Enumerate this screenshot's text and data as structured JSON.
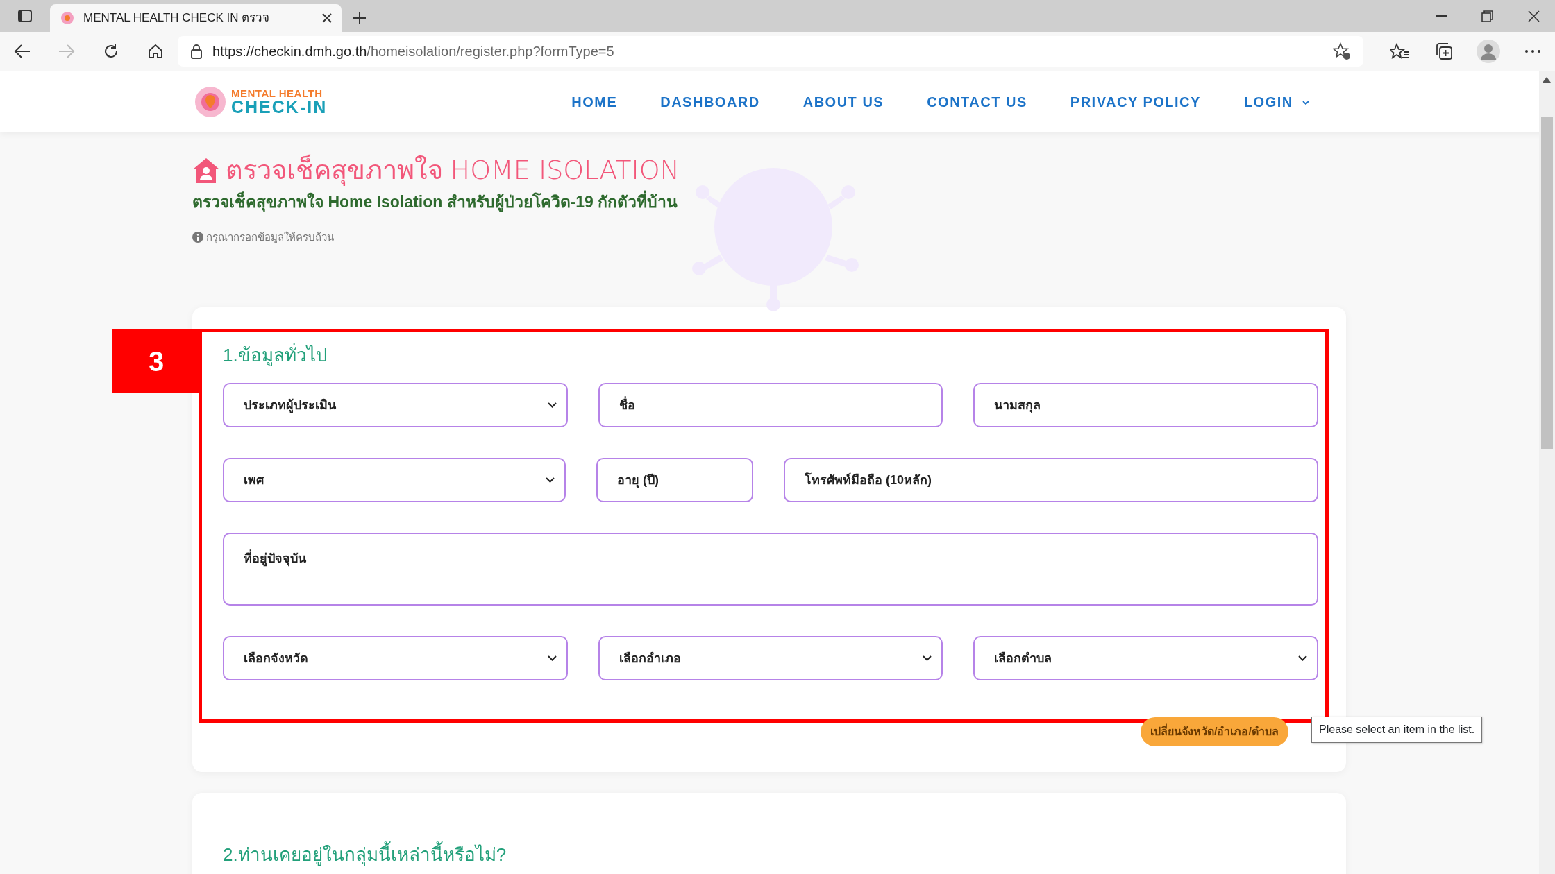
{
  "browser": {
    "tab_title": "MENTAL HEALTH CHECK IN ตรวจ",
    "url_host": "https://checkin.dmh.go.th",
    "url_path": "/homeisolation/register.php?formType=5"
  },
  "site": {
    "logo_top": "MENTAL HEALTH",
    "logo_bottom": "CHECK-IN",
    "nav": [
      {
        "label": "HOME",
        "dropdown": false
      },
      {
        "label": "DASHBOARD",
        "dropdown": false
      },
      {
        "label": "ABOUT US",
        "dropdown": false
      },
      {
        "label": "CONTACT US",
        "dropdown": false
      },
      {
        "label": "PRIVACY POLICY",
        "dropdown": false
      },
      {
        "label": "LOGIN",
        "dropdown": true
      }
    ]
  },
  "page": {
    "title_thai": "ตรวจเช็คสุขภาพใจ",
    "title_en": "HOME ISOLATION",
    "subtitle": "ตรวจเช็คสุขภาพใจ Home Isolation สำหรับผู้ป่วยโควิด-19 กักตัวที่บ้าน",
    "notice": "กรุณากรอกข้อมูลให้ครบถ้วน"
  },
  "annotation": {
    "label": "3"
  },
  "section_1": {
    "heading": "1.ข้อมูลทั่วไป",
    "rows": [
      [
        {
          "kind": "select",
          "value": "ประเภทผู้ประเมิน"
        },
        {
          "kind": "input",
          "placeholder": "ชื่อ"
        },
        {
          "kind": "input",
          "placeholder": "นามสกุล"
        }
      ],
      [
        {
          "kind": "select",
          "value": "เพศ"
        },
        {
          "kind": "input",
          "placeholder": "อายุ (ปี)"
        },
        {
          "kind": "input",
          "placeholder": "โทรศัพท์มือถือ (10หลัก)"
        }
      ],
      [
        {
          "kind": "textarea",
          "placeholder": "ที่อยู่ปัจจุบัน"
        }
      ],
      [
        {
          "kind": "select",
          "value": "เลือกจังหวัด"
        },
        {
          "kind": "select",
          "value": "เลือกอำเภอ"
        },
        {
          "kind": "select",
          "value": "เลือกตำบล"
        }
      ]
    ],
    "change_button": "เปลี่ยนจังหวัด/อำเภอ/ตำบล",
    "tooltip": "Please select an item in the list."
  },
  "section_2": {
    "heading": "2.ท่านเคยอยู่ในกลุ่มนี้เหล่านี้หรือไม่?"
  }
}
